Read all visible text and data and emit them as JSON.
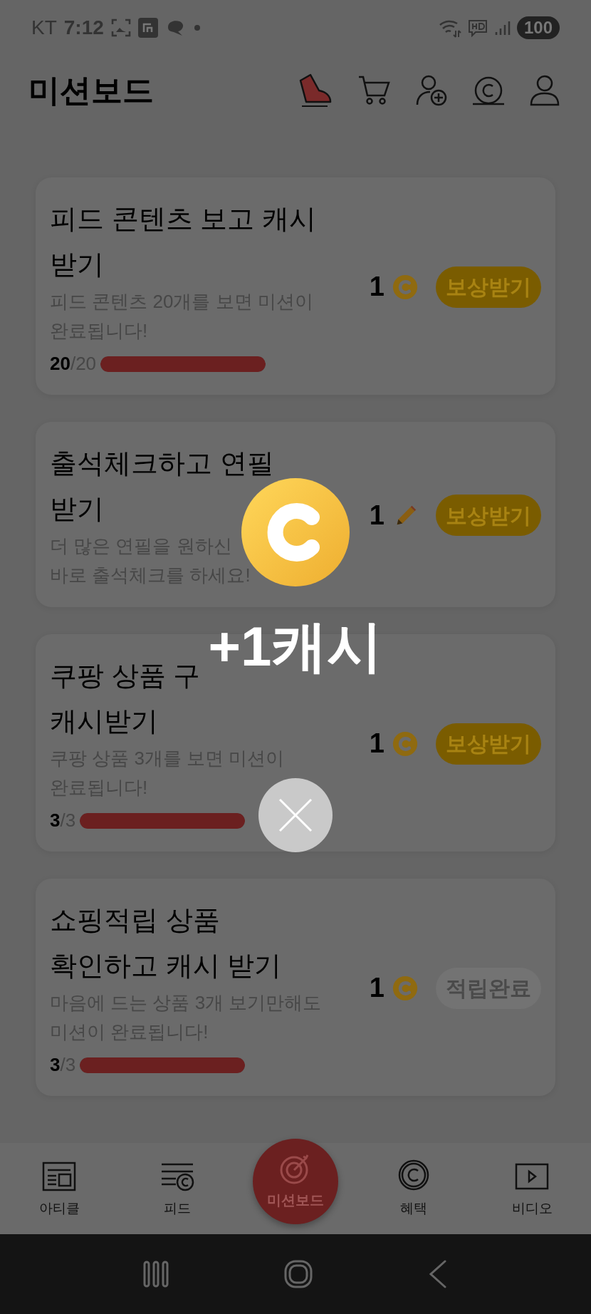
{
  "status_bar": {
    "carrier": "KT",
    "time": "7:12",
    "battery": "100"
  },
  "header": {
    "title": "미션보드"
  },
  "missions": [
    {
      "title_lines": [
        "피드 콘텐츠 보고 캐시",
        "받기"
      ],
      "description_lines": [
        "피드 콘텐츠 20개를 보면 미션이",
        "완료됩니다!"
      ],
      "done": "20",
      "total": "/20",
      "level": 1,
      "reward": "1",
      "kind": "cash",
      "button": "보상받기",
      "completed": false
    },
    {
      "title_lines": [
        "출석체크하고 연필",
        "받기"
      ],
      "description_lines": [
        "더 많은 연필을 원하신",
        "바로 출석체크를 하세요!"
      ],
      "reward": "1",
      "kind": "pencil",
      "button": "보상받기",
      "completed": false
    },
    {
      "title_lines": [
        "쿠팡 상품 구",
        "캐시받기"
      ],
      "description_lines": [
        "쿠팡 상품 3개를 보면 미션이",
        "완료됩니다!"
      ],
      "done": "3",
      "total": "/3",
      "level": 1,
      "reward": "1",
      "kind": "cash",
      "button": "보상받기",
      "completed": false
    },
    {
      "title_lines": [
        "쇼핑적립 상품",
        "확인하고 캐시 받기"
      ],
      "description_lines": [
        "마음에 드는 상품 3개 보기만해도",
        "미션이 완료됩니다!"
      ],
      "done": "3",
      "total": "/3",
      "level": 1,
      "reward": "1",
      "kind": "cash",
      "button": "적립완료",
      "completed": true
    }
  ],
  "popup": {
    "amount": "+1캐시"
  },
  "bottom_nav": [
    {
      "label": "아티클",
      "selected": false
    },
    {
      "label": "피드",
      "selected": false
    },
    {
      "label": "미션보드",
      "selected": true
    },
    {
      "label": "혜택",
      "selected": false
    },
    {
      "label": "비디오",
      "selected": false
    }
  ]
}
